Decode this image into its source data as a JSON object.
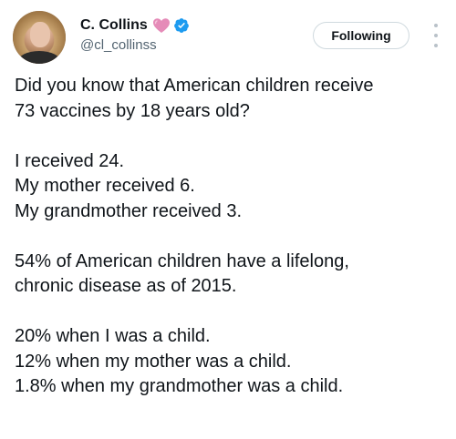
{
  "author": {
    "display_name": "C. Collins",
    "handle": "@cl_collinss",
    "emoji_icon": "pink-heart-icon",
    "badge_icon": "verified-badge-icon",
    "badge_color": "#1d9bf0",
    "heart_color": "#e58bb8"
  },
  "actions": {
    "follow_label": "Following",
    "more_icon": "more-options-icon"
  },
  "tweet": {
    "paragraphs": [
      {
        "lines": [
          "Did you know that American children receive",
          "73 vaccines by 18 years old?"
        ]
      },
      {
        "lines": [
          "I received 24.",
          "My mother received 6.",
          "My grandmother received 3."
        ]
      },
      {
        "lines": [
          "54% of American children have a lifelong,",
          "chronic disease as of 2015."
        ]
      },
      {
        "lines": [
          "20% when I was a child.",
          "12% when my mother was a child.",
          "1.8% when my grandmother was a child."
        ]
      }
    ]
  }
}
